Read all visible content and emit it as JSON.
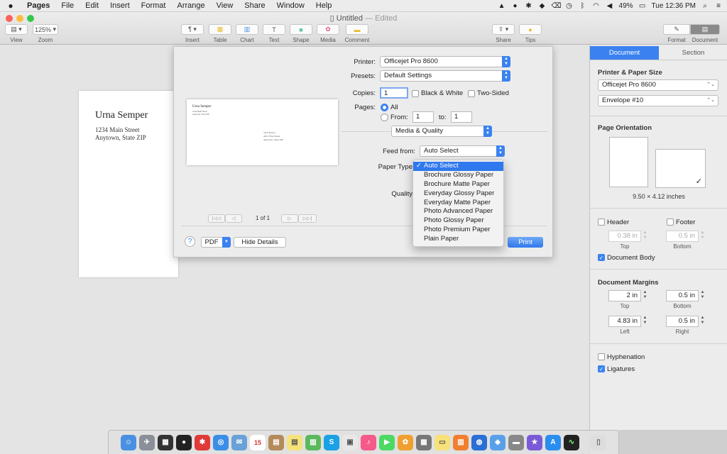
{
  "menubar": {
    "apple": "",
    "app_name": "Pages",
    "items": [
      "File",
      "Edit",
      "Insert",
      "Format",
      "Arrange",
      "View",
      "Share",
      "Window",
      "Help"
    ],
    "battery": "49%",
    "clock": "Tue 12:36 PM"
  },
  "window": {
    "title": "Untitled",
    "edited": "— Edited"
  },
  "toolbar": {
    "view_label": "View",
    "zoom_value": "125%",
    "zoom_label": "Zoom",
    "insert_label": "Insert",
    "table_label": "Table",
    "chart_label": "Chart",
    "text_label": "Text",
    "shape_label": "Shape",
    "media_label": "Media",
    "comment_label": "Comment",
    "share_label": "Share",
    "tips_label": "Tips",
    "format_label": "Format",
    "document_label": "Document"
  },
  "document": {
    "sender_name": "Urna Semper",
    "sender_line1": "1234 Main Street",
    "sender_line2": "Anytown, State ZIP"
  },
  "preview": {
    "name": "Urna Semper",
    "line1": "1234 Main Street",
    "line2": "Anytown, State ZIP",
    "recipient1": "Tecti Prieve",
    "recipient2": "4321 First Street",
    "recipient3": "Anytown, State ZIP",
    "page_text": "1 of 1"
  },
  "print_dialog": {
    "printer_label": "Printer:",
    "printer_value": "Officejet Pro 8600",
    "presets_label": "Presets:",
    "presets_value": "Default Settings",
    "copies_label": "Copies:",
    "copies_value": "1",
    "bw_label": "Black & White",
    "two_sided_label": "Two-Sided",
    "pages_label": "Pages:",
    "all_label": "All",
    "from_label": "From:",
    "from_value": "1",
    "to_label": "to:",
    "to_value": "1",
    "section_value": "Media & Quality",
    "feed_label": "Feed from:",
    "feed_value": "Auto Select",
    "paper_type_label": "Paper Type",
    "quality_label": "Quality",
    "help_label": "?",
    "pdf_label": "PDF",
    "hide_details_label": "Hide Details",
    "print_label": "Print"
  },
  "paper_type_menu": {
    "selected": "Auto Select",
    "items": [
      "Auto Select",
      "Brochure Glossy Paper",
      "Brochure Matte Paper",
      "Everyday Glossy Paper",
      "Everyday Matte Paper",
      "Photo Advanced Paper",
      "Photo Glossy Paper",
      "Photo Premium Paper",
      "Plain Paper"
    ]
  },
  "inspector": {
    "tab_document": "Document",
    "tab_section": "Section",
    "printer_paper_heading": "Printer & Paper Size",
    "printer_value": "Officejet Pro 8600",
    "paper_value": "Envelope #10",
    "orientation_heading": "Page Orientation",
    "paper_dims": "9.50 × 4.12 inches",
    "header_label": "Header",
    "footer_label": "Footer",
    "header_value": "0.38 in",
    "footer_value": "0.5 in",
    "top_label": "Top",
    "bottom_label": "Bottom",
    "document_body_label": "Document Body",
    "margins_heading": "Document Margins",
    "margin_top": "2 in",
    "margin_bottom": "0.5 in",
    "margin_left": "4.83 in",
    "margin_right": "0.5 in",
    "left_label": "Left",
    "right_label": "Right",
    "hyphenation_label": "Hyphenation",
    "ligatures_label": "Ligatures"
  },
  "dock": {
    "calendar_day": "15"
  },
  "colors": {
    "accent": "#3b82f0"
  }
}
